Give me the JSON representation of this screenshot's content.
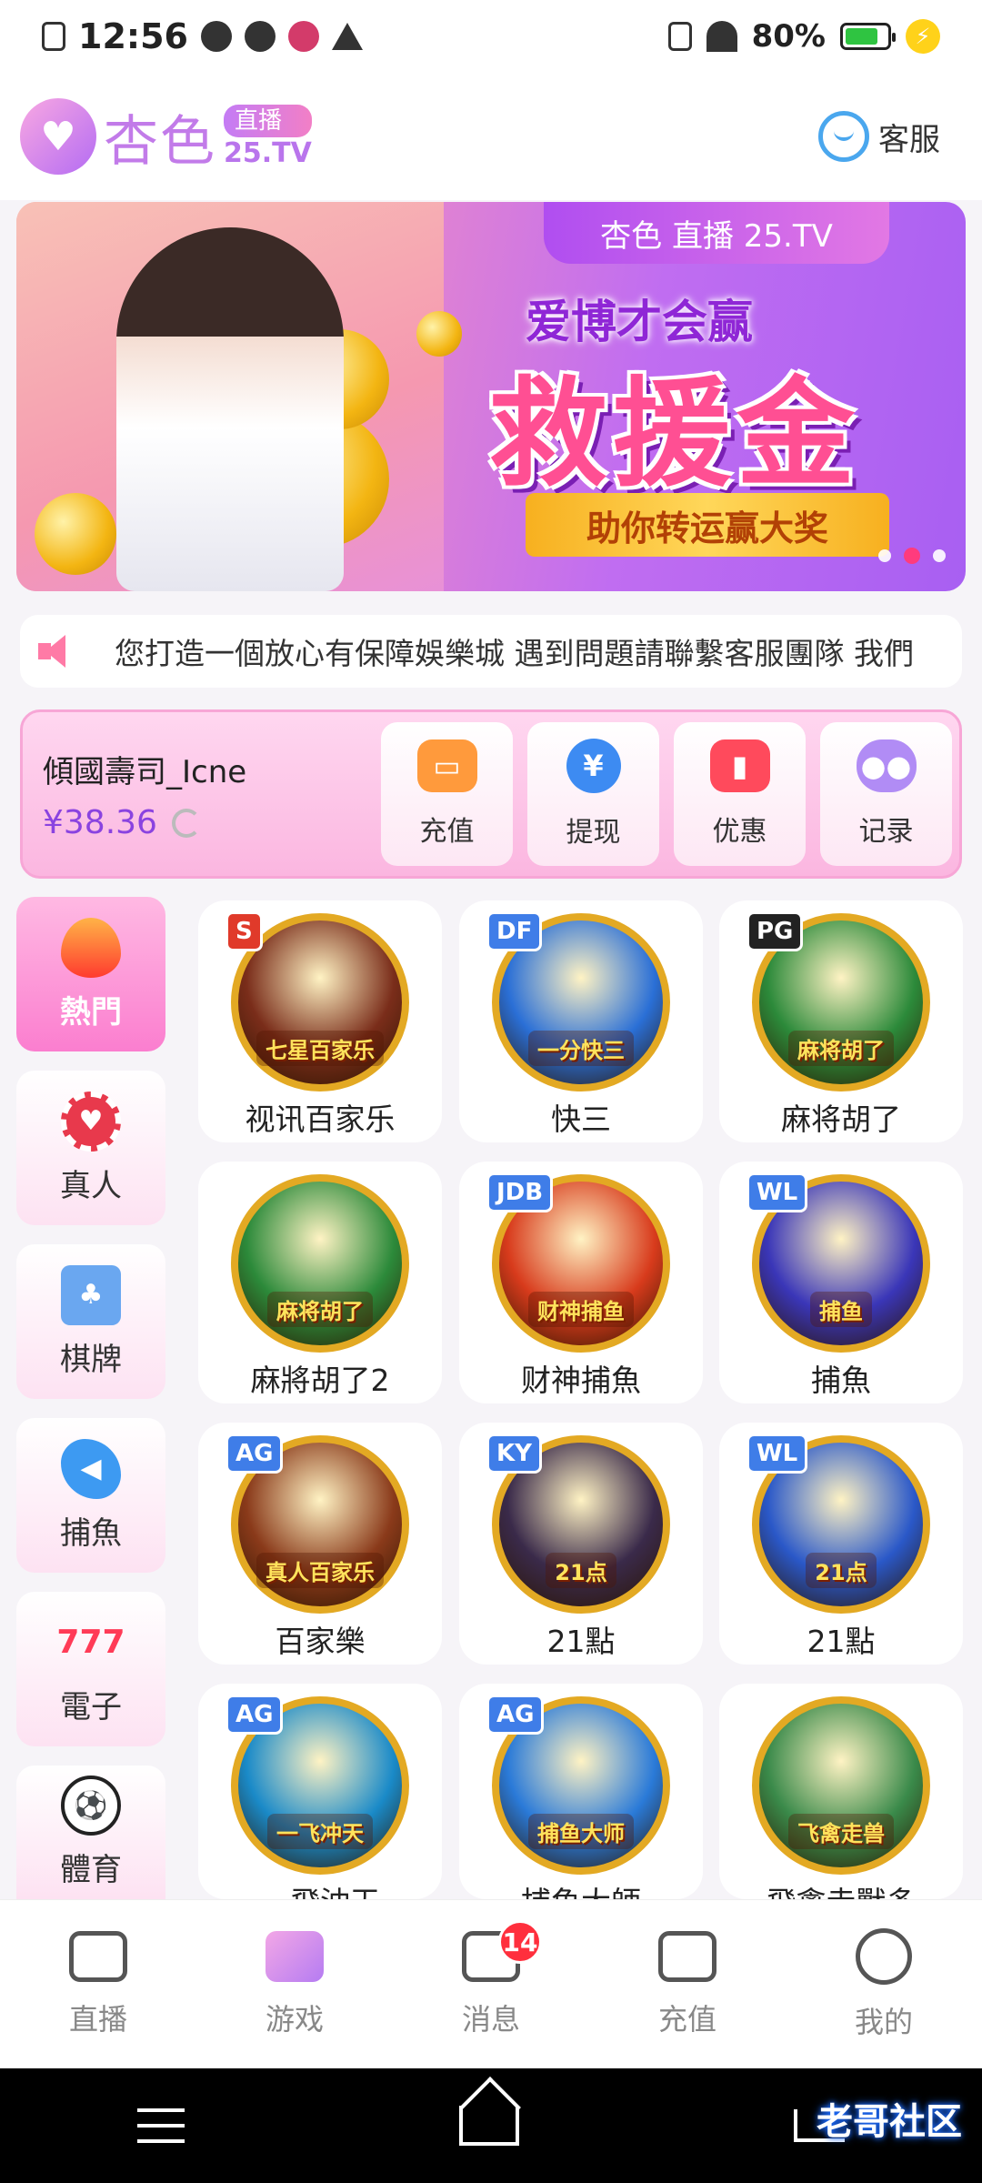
{
  "status": {
    "time": "12:56",
    "battery": "80%",
    "battery_level": 0.8
  },
  "header": {
    "logo_main": "杏色",
    "logo_pill": "直播",
    "logo_domain": "25.TV",
    "service_label": "客服"
  },
  "banner": {
    "tag": "杏色 直播 25.TV",
    "subtitle": "爱博才会赢",
    "title": "救援金",
    "ribbon": "助你转运赢大奖",
    "slides": 3,
    "active_slide": 2
  },
  "notice": {
    "text": "您打造一個放心有保障娛樂城  遇到問題請聯繫客服團隊 我們"
  },
  "wallet": {
    "username": "傾國壽司_Icne",
    "balance": "¥38.36",
    "actions": [
      {
        "label": "充值",
        "icon": "wallet-icon",
        "color": "#ff9a3c"
      },
      {
        "label": "提现",
        "icon": "yuan-icon",
        "color": "#3d8bf2"
      },
      {
        "label": "优惠",
        "icon": "ticket-icon",
        "color": "#ff4a5c"
      },
      {
        "label": "记录",
        "icon": "gamepad-icon",
        "color": "#b18cf5"
      }
    ]
  },
  "categories": [
    {
      "label": "熱門",
      "icon": "flame-icon",
      "active": true
    },
    {
      "label": "真人",
      "icon": "chip-icon"
    },
    {
      "label": "棋牌",
      "icon": "cards-icon"
    },
    {
      "label": "捕魚",
      "icon": "shark-icon"
    },
    {
      "label": "電子",
      "icon": "slot-777-icon"
    },
    {
      "label": "體育",
      "icon": "soccer-ball-icon"
    }
  ],
  "games": [
    {
      "name": "视讯百家乐",
      "art_text": "七星百家乐",
      "badge": "S",
      "color": "#7a2d1a"
    },
    {
      "name": "快三",
      "art_text": "一分快三",
      "badge": "DF",
      "color": "#2a6fd6"
    },
    {
      "name": "麻将胡了",
      "art_text": "麻将胡了",
      "badge": "PG",
      "color": "#2c8a3a"
    },
    {
      "name": "麻將胡了2",
      "art_text": "麻将胡了",
      "badge": "",
      "color": "#2c8a3a"
    },
    {
      "name": "财神捕魚",
      "art_text": "财神捕鱼",
      "badge": "JDB",
      "color": "#d83b1c"
    },
    {
      "name": "捕魚",
      "art_text": "捕鱼",
      "badge": "WL",
      "color": "#3a36b8"
    },
    {
      "name": "百家樂",
      "art_text": "真人百家乐",
      "badge": "AG",
      "color": "#8a3a1a"
    },
    {
      "name": "21點",
      "art_text": "21点",
      "badge": "KY",
      "color": "#3a2a4a"
    },
    {
      "name": "21點",
      "art_text": "21点",
      "badge": "WL",
      "color": "#2a58c8"
    },
    {
      "name": "一飛沖天",
      "art_text": "一飞冲天",
      "badge": "AG",
      "color": "#1a8ac8"
    },
    {
      "name": "捕魚大師",
      "art_text": "捕鱼大师",
      "badge": "AG",
      "color": "#2a7ad8"
    },
    {
      "name": "飛禽走獸多",
      "art_text": "飞禽走兽",
      "badge": "",
      "color": "#3a8a4a"
    }
  ],
  "bottom_nav": [
    {
      "label": "直播",
      "icon": "video-camera-icon"
    },
    {
      "label": "游戏",
      "icon": "gamepad-icon",
      "active": true
    },
    {
      "label": "消息",
      "icon": "message-icon",
      "badge": "14"
    },
    {
      "label": "充值",
      "icon": "wallet-icon"
    },
    {
      "label": "我的",
      "icon": "smiley-icon"
    }
  ],
  "watermark": "老哥社区"
}
